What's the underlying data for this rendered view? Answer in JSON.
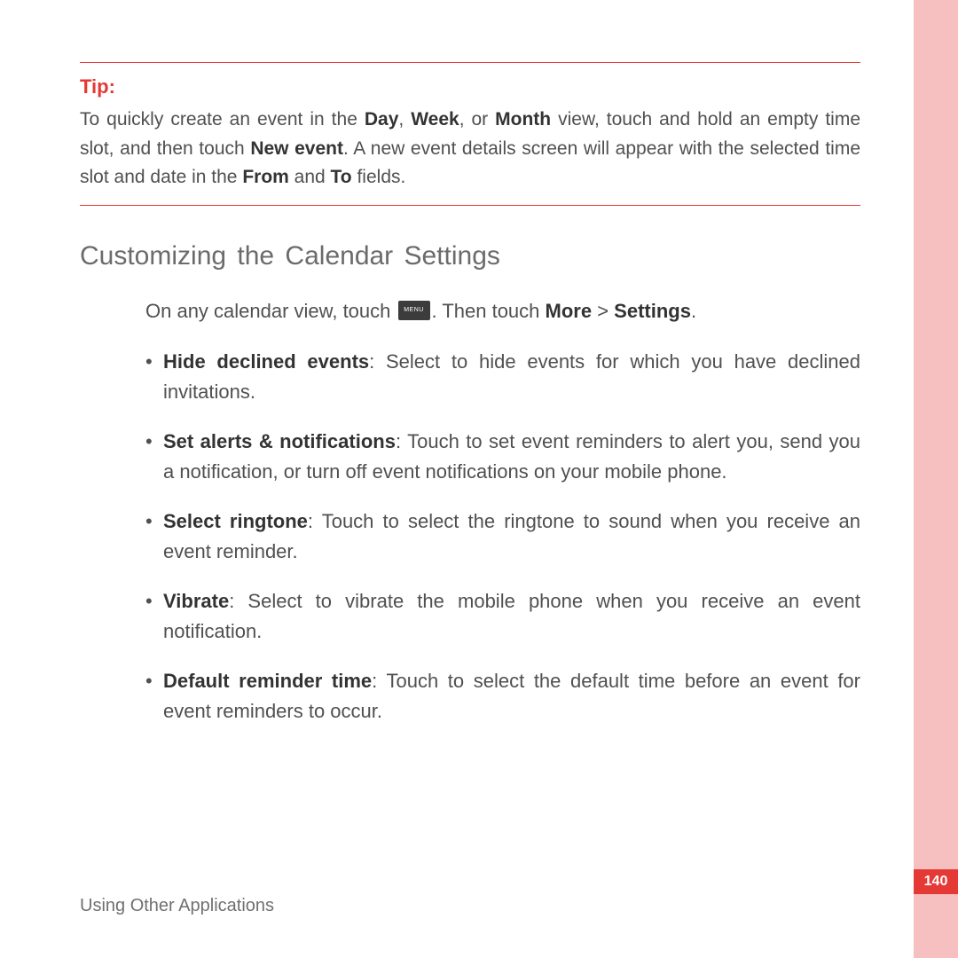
{
  "tip": {
    "label": "Tip:",
    "body_parts": {
      "t1": "To quickly create an event in the ",
      "b1": "Day",
      "t2": ", ",
      "b2": "Week",
      "t3": ", or ",
      "b3": "Month",
      "t4": " view, touch and hold an empty time slot, and then touch ",
      "b4": "New event",
      "t5": ". A new event details screen will appear with the selected time slot and date in the ",
      "b5": "From",
      "t6": " and ",
      "b6": "To",
      "t7": " fields."
    }
  },
  "section_heading": "Customizing the Calendar Settings",
  "intro": {
    "t1": "On any calendar view, touch ",
    "icon_label": "MENU",
    "t2": ". Then touch ",
    "b1": "More",
    "t3": " > ",
    "b2": "Settings",
    "t4": "."
  },
  "settings": [
    {
      "label": "Hide declined events",
      "desc": ": Select to hide events for which you have declined invitations."
    },
    {
      "label": "Set alerts & notifications",
      "desc": ": Touch to set event reminders to alert you, send you a notification, or turn off event notifications on your mobile phone."
    },
    {
      "label": "Select ringtone",
      "desc": ": Touch to select the ringtone to sound when you receive an event reminder."
    },
    {
      "label": "Vibrate",
      "desc": ": Select to vibrate the mobile phone when you receive an event notification."
    },
    {
      "label": "Default reminder time",
      "desc": ": Touch to select the default time before an event for event reminders to occur."
    }
  ],
  "footer": "Using Other Applications",
  "page_number": "140"
}
